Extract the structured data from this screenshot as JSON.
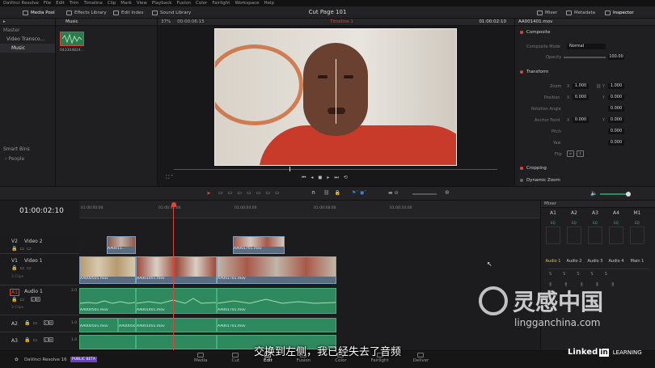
{
  "menu": [
    "DaVinci Resolve",
    "File",
    "Edit",
    "Trim",
    "Timeline",
    "Clip",
    "Mark",
    "View",
    "Playback",
    "Fusion",
    "Color",
    "Fairlight",
    "Workspace",
    "Help"
  ],
  "toolbar": {
    "media_pool": "Media Pool",
    "effects_library": "Effects Library",
    "edit_index": "Edit Index",
    "sound_library": "Sound Library",
    "title": "Cut Page 101",
    "mixer": "Mixer",
    "metadata": "Metadata",
    "inspector": "Inspector"
  },
  "pool": {
    "bin_label": "Music",
    "folders": [
      "Master",
      "Video Transco...",
      "Music"
    ],
    "clip_name": "043304824...",
    "smart_bins": "Smart Bins",
    "people": "People"
  },
  "viewer": {
    "zoom": "37%",
    "timecode": "00:00:06:15",
    "timeline_name": "Timeline 1",
    "right_tc": "01:00:02:10"
  },
  "inspector": {
    "clip_name": "AA001401.mov",
    "composite": "Composite",
    "composite_mode_label": "Composite Mode",
    "composite_mode": "Normal",
    "opacity_label": "Opacity",
    "opacity": "100.00",
    "transform": "Transform",
    "zoom_label": "Zoom",
    "zoom_x": "1.000",
    "zoom_y": "1.000",
    "position_label": "Position",
    "pos_x": "0.000",
    "pos_y": "0.000",
    "rotation_label": "Rotation Angle",
    "rotation": "0.000",
    "anchor_label": "Anchor Point",
    "anchor_x": "0.000",
    "anchor_y": "0.000",
    "pitch_label": "Pitch",
    "pitch": "0.000",
    "yaw_label": "Yaw",
    "yaw": "0.000",
    "flip_label": "Flip",
    "cropping": "Cropping",
    "dynamic_zoom": "Dynamic Zoom",
    "x": "X",
    "y": "Y"
  },
  "timeline": {
    "timecode": "01:00:02:10",
    "ruler": [
      "01:00:00:00",
      "01:00:02:00",
      "01:00:04:00",
      "01:00:08:00",
      "01:00:10:00"
    ],
    "tracks": {
      "v2": "V2",
      "v2_name": "Video 2",
      "v1": "V1",
      "v1_name": "Video 1",
      "v1_clips": "3 Clips",
      "a1": "A1",
      "a1_name": "Audio 1",
      "a1_level": "2.0",
      "a1_clips": "3 Clips",
      "a2": "A2",
      "a2_level": "1.0",
      "a3": "A3",
      "a3_level": "1.0"
    },
    "clips": {
      "v2a": "AA0011...",
      "v2b": "AA001701.mov",
      "v1a": "AA000501.mov",
      "v1b": "AA001401.mov",
      "v1c": "AA001701.mov",
      "a1a": "AA000501.mov",
      "a1b": "AA001401.mov",
      "a1c": "AA001701.mov",
      "a2a": "AA000501.mov",
      "a2b": "AA001401.mov",
      "a2c": "AA001701.mov",
      "a2x": "AA000501.mov"
    }
  },
  "mixer": {
    "title": "Mixer",
    "channels": [
      "A1",
      "A2",
      "A3",
      "A4",
      "M1"
    ],
    "buses": [
      "Audio 1",
      "Audio 2",
      "Audio 3",
      "Audio 4",
      "Main 1"
    ],
    "eq": "EQ"
  },
  "bottom": {
    "app": "DaVinci Resolve 16",
    "beta": "PUBLIC BETA",
    "pages": [
      "Media",
      "Cut",
      "Edit",
      "Fusion",
      "Color",
      "Fairlight",
      "Deliver"
    ],
    "active": "Edit"
  },
  "subtitle": "交换到左侧，我已经失去了音频",
  "watermark": {
    "cn": "灵感中国",
    "url": "lingganchina.com",
    "brand": "Linked",
    "brand_in": "in",
    "learning": "LEARNING"
  },
  "colors": {
    "accent": "#e0433a",
    "video_clip": "#5a6c80",
    "audio_clip": "#2e8a5e"
  }
}
